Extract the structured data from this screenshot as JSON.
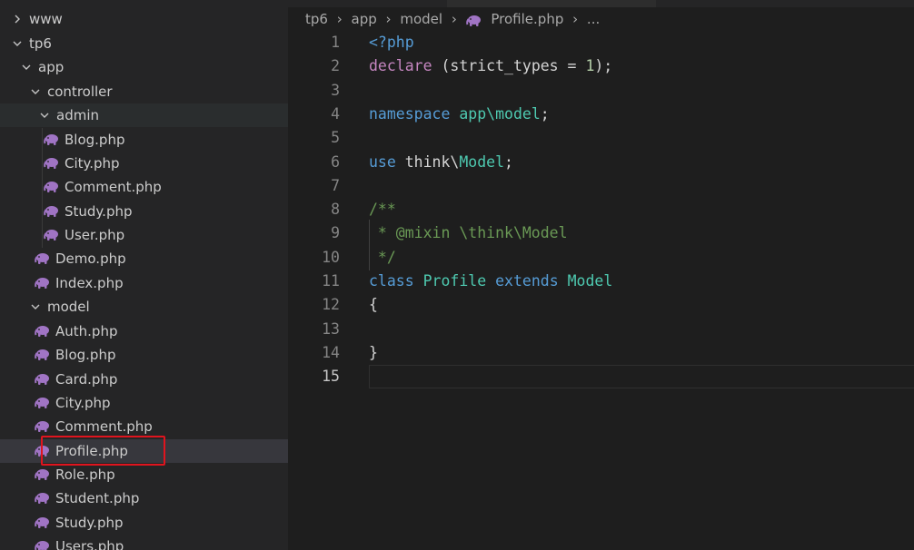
{
  "explorer": {
    "items": [
      {
        "label": "www",
        "kind": "folder",
        "expanded": false
      },
      {
        "label": "tp6",
        "kind": "folder",
        "expanded": true
      },
      {
        "label": "app",
        "kind": "folder",
        "expanded": true
      },
      {
        "label": "controller",
        "kind": "folder",
        "expanded": true
      },
      {
        "label": "admin",
        "kind": "folder",
        "expanded": true
      },
      {
        "label": "Blog.php",
        "kind": "file"
      },
      {
        "label": "City.php",
        "kind": "file"
      },
      {
        "label": "Comment.php",
        "kind": "file"
      },
      {
        "label": "Study.php",
        "kind": "file"
      },
      {
        "label": "User.php",
        "kind": "file"
      },
      {
        "label": "Demo.php",
        "kind": "file"
      },
      {
        "label": "Index.php",
        "kind": "file"
      },
      {
        "label": "model",
        "kind": "folder",
        "expanded": true
      },
      {
        "label": "Auth.php",
        "kind": "file"
      },
      {
        "label": "Blog.php",
        "kind": "file"
      },
      {
        "label": "Card.php",
        "kind": "file"
      },
      {
        "label": "City.php",
        "kind": "file"
      },
      {
        "label": "Comment.php",
        "kind": "file"
      },
      {
        "label": "Profile.php",
        "kind": "file",
        "selected": true
      },
      {
        "label": "Role.php",
        "kind": "file"
      },
      {
        "label": "Student.php",
        "kind": "file"
      },
      {
        "label": "Study.php",
        "kind": "file"
      },
      {
        "label": "Users.php",
        "kind": "file"
      }
    ]
  },
  "breadcrumb": {
    "parts": [
      "tp6",
      "app",
      "model"
    ],
    "file": "Profile.php",
    "more": "..."
  },
  "editor": {
    "active_line": 15,
    "lines": [
      {
        "n": "1",
        "tokens": [
          {
            "t": "<?php",
            "c": "#569cd6"
          }
        ]
      },
      {
        "n": "2",
        "tokens": [
          {
            "t": "declare",
            "c": "#c586c0"
          },
          {
            "t": " (strict_types = ",
            "c": "#d4d4d4"
          },
          {
            "t": "1",
            "c": "#b5cea8"
          },
          {
            "t": ");",
            "c": "#d4d4d4"
          }
        ]
      },
      {
        "n": "3",
        "tokens": []
      },
      {
        "n": "4",
        "tokens": [
          {
            "t": "namespace",
            "c": "#569cd6"
          },
          {
            "t": " ",
            "c": "#d4d4d4"
          },
          {
            "t": "app\\model",
            "c": "#4ec9b0"
          },
          {
            "t": ";",
            "c": "#d4d4d4"
          }
        ]
      },
      {
        "n": "5",
        "tokens": []
      },
      {
        "n": "6",
        "tokens": [
          {
            "t": "use",
            "c": "#569cd6"
          },
          {
            "t": " think\\",
            "c": "#d4d4d4"
          },
          {
            "t": "Model",
            "c": "#4ec9b0"
          },
          {
            "t": ";",
            "c": "#d4d4d4"
          }
        ]
      },
      {
        "n": "7",
        "tokens": []
      },
      {
        "n": "8",
        "tokens": [
          {
            "t": "/**",
            "c": "#6a9955"
          }
        ]
      },
      {
        "n": "9",
        "tokens": [
          {
            "t": " * @mixin \\think\\Model",
            "c": "#6a9955"
          }
        ]
      },
      {
        "n": "10",
        "tokens": [
          {
            "t": " */",
            "c": "#6a9955"
          }
        ]
      },
      {
        "n": "11",
        "tokens": [
          {
            "t": "class",
            "c": "#569cd6"
          },
          {
            "t": " ",
            "c": "#d4d4d4"
          },
          {
            "t": "Profile",
            "c": "#4ec9b0"
          },
          {
            "t": " ",
            "c": "#d4d4d4"
          },
          {
            "t": "extends",
            "c": "#569cd6"
          },
          {
            "t": " ",
            "c": "#d4d4d4"
          },
          {
            "t": "Model",
            "c": "#4ec9b0"
          }
        ]
      },
      {
        "n": "12",
        "tokens": [
          {
            "t": "{",
            "c": "#d4d4d4"
          }
        ]
      },
      {
        "n": "13",
        "tokens": []
      },
      {
        "n": "14",
        "tokens": [
          {
            "t": "}",
            "c": "#d4d4d4"
          }
        ]
      },
      {
        "n": "15",
        "tokens": []
      }
    ]
  },
  "colors": {
    "sidebar_bg": "#252526",
    "editor_bg": "#1e1e1e",
    "php_icon": "#a074c4",
    "highlight_box": "#e0141e"
  },
  "icons": {
    "file": "php-elephant-icon",
    "collapsed": "chevron-right-icon",
    "expanded": "chevron-down-icon"
  }
}
